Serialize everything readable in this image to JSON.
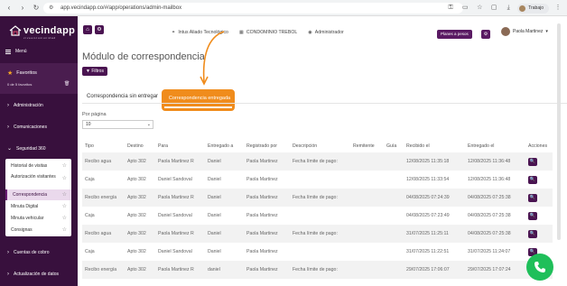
{
  "browser": {
    "url": "app.vecindapp.co/#/app/operations/admin-mailbox",
    "profile_name": "Trabajo"
  },
  "sidebar": {
    "brand": "vecindapp",
    "tagline": "v i v e   e n   c o m u n i d a d",
    "menu_label": "Menú",
    "favorites_title": "Favoritos",
    "favorites_count": "0 de 5 favoritos",
    "sections": [
      {
        "label": "Administración"
      },
      {
        "label": "Comunicaciones"
      },
      {
        "label": "Seguridad 360"
      },
      {
        "label": "Cuentas de cobro"
      },
      {
        "label": "Actualización de datos"
      }
    ],
    "security_items": [
      {
        "label": "Historial de visitas",
        "active": false
      },
      {
        "label": "Autorización visitantes",
        "active": false
      },
      {
        "label": "Correspondencia",
        "active": true
      },
      {
        "label": "Minuta Digital",
        "active": false
      },
      {
        "label": "Minuta vehicular",
        "active": false
      },
      {
        "label": "Consignas",
        "active": false
      }
    ]
  },
  "topbar": {
    "link1": "Intus Aliado Tecnológico",
    "link2": "CONDOMINIO TREBOL",
    "link3": "Administrador",
    "plans_button": "Planes a pesos",
    "user_name": "Paola Martinez"
  },
  "page": {
    "title": "Módulo de correspondencia",
    "filters_button": "Filtros",
    "tabs": [
      "Correspondencia sin entregar",
      "Correspondencia entregada"
    ],
    "per_page_label": "Por página",
    "per_page_value": "10"
  },
  "table": {
    "headers": [
      "Tipo",
      "Destino",
      "Para",
      "Entregado a",
      "Registrado por",
      "Descripción",
      "Remitente",
      "Guía",
      "Recibido el",
      "Entregado el",
      "Acciones"
    ],
    "rows": [
      [
        "Recibo agua",
        "Apto 302",
        "Paola Martinez R",
        "Daniel",
        "Paola Martinez",
        "Fecha límite de pago:",
        "",
        "",
        "12/08/2025 11:35:18",
        "12/08/2025 11:36:48"
      ],
      [
        "Caja",
        "Apto 302",
        "Daniel Sandoval",
        "Daniel",
        "Paola Martinez",
        "",
        "",
        "",
        "12/08/2025 11:33:54",
        "12/08/2025 11:36:48"
      ],
      [
        "Recibo energía",
        "Apto 302",
        "Paola Martinez R",
        "Daniel",
        "Paola Martinez",
        "Fecha límite de pago:",
        "",
        "",
        "04/08/2025 07:24:39",
        "04/08/2025 07:25:38"
      ],
      [
        "Caja",
        "Apto 302",
        "Daniel Sandoval",
        "Daniel",
        "Paola Martinez",
        "",
        "",
        "",
        "04/08/2025 07:23:49",
        "04/08/2025 07:25:38"
      ],
      [
        "Recibo agua",
        "Apto 302",
        "Paola Martinez R",
        "Daniel",
        "Paola Martinez",
        "Fecha límite de pago:",
        "",
        "",
        "31/07/2025 11:25:11",
        "04/08/2025 07:25:38"
      ],
      [
        "Caja",
        "Apto 302",
        "Daniel Sandoval",
        "Daniel",
        "Paola Martinez",
        "",
        "",
        "",
        "31/07/2025 11:22:51",
        "31/07/2025 11:24:07"
      ],
      [
        "Recibo energía",
        "Apto 302",
        "Paola Martinez R",
        "daniel",
        "Paola Martinez",
        "Fecha límite de pago:",
        "",
        "",
        "29/07/2025 17:06:07",
        "29/07/2025 17:07:24"
      ]
    ]
  },
  "colors": {
    "sidebar": "#38103d",
    "accent": "#4a1451",
    "highlight": "#f08c1c",
    "whatsapp": "#1fbf5a"
  }
}
